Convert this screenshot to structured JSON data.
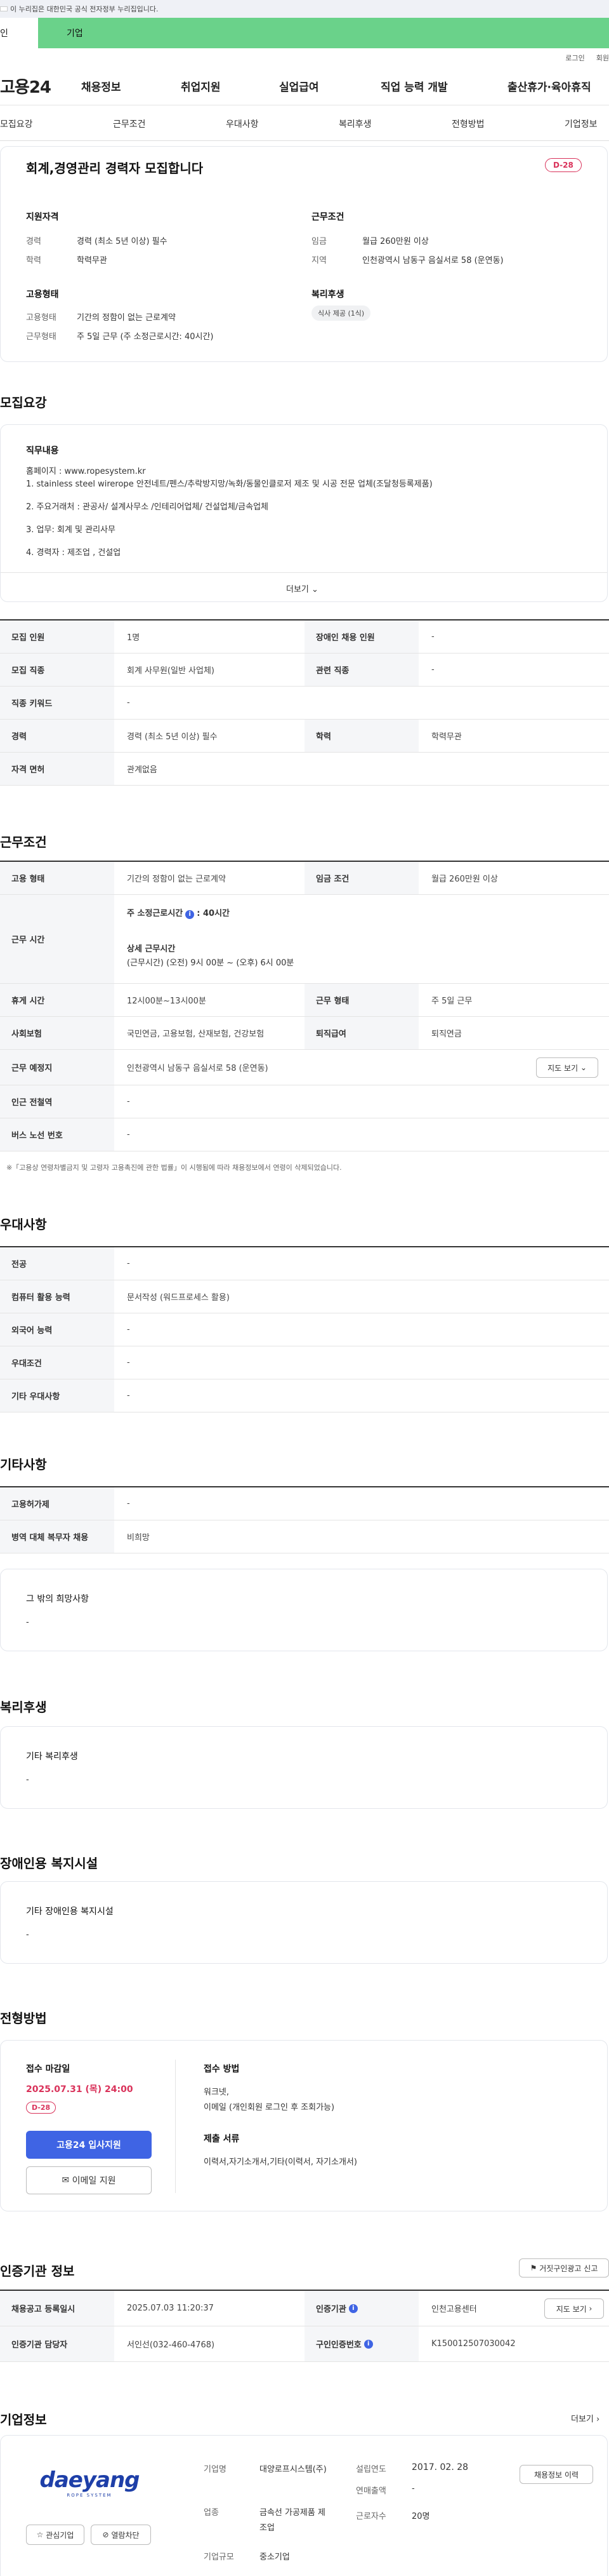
{
  "gov_banner": "이 누리집은 대한민국 공식 전자정부 누리집입니다.",
  "strip": {
    "left": "인",
    "right": "기업"
  },
  "util": [
    "로그인",
    "회원"
  ],
  "logo": "고용24",
  "gnb": [
    "채용정보",
    "취업지원",
    "실업급여",
    "직업 능력 개발",
    "출산휴가·육아휴직"
  ],
  "snb": [
    "모집요강",
    "근무조건",
    "우대사항",
    "복리후생",
    "전형방법",
    "기업정보"
  ],
  "summary": {
    "title": "회계,경영관리 경력자 모집합니다",
    "dday": "D-28",
    "qual_title": "지원자격",
    "career_k": "경력",
    "career_v": "경력 (최소 5년 이상) 필수",
    "edu_k": "학력",
    "edu_v": "학력무관",
    "cond_title": "근무조건",
    "wage_k": "임금",
    "wage_v": "월급 260만원 이상",
    "region_k": "지역",
    "region_v": "인천광역시 남동구 음실서로 58 (운연동)",
    "emp_title": "고용형태",
    "emptype_k": "고용형태",
    "emptype_v": "기간의 정함이 없는 근로계약",
    "worktype_k": "근무형태",
    "worktype_v": "주 5일 근무 (주 소정근로시간: 40시간)",
    "welfare_title": "복리후생",
    "welfare_chip": "식사 제공 (1식)"
  },
  "recruit": {
    "section": "모집요강",
    "duty_title": "직무내용",
    "duty_lines": [
      "홈페이지 : www.ropesystem.kr",
      "1. stainless steel wirerope 안전네트/펜스/추락방지망/녹화/동물인클로저 제조 및 시공 전문 업체(조달청등록제품)",
      "2. 주요거래처 : 관공사/ 설계사무소 /인테리어업체/ 건설업체/금속업체",
      "3. 업무: 회계 및 관리사무",
      "4. 경력자 : 제조업 , 건설업"
    ],
    "more": "더보기",
    "rows": [
      [
        "모집 인원",
        "1명",
        "장애인 채용 인원",
        "-"
      ],
      [
        "모집 직종",
        "회계 사무원(일반 사업체)",
        "관련 직종",
        "-"
      ],
      [
        "직종 키워드",
        "-"
      ],
      [
        "경력",
        "경력 (최소 5년 이상) 필수",
        "학력",
        "학력무관"
      ],
      [
        "자격 면허",
        "관계없음"
      ]
    ]
  },
  "work": {
    "section": "근무조건",
    "emp_k": "고용 형태",
    "emp_v": "기간의 정함이 없는 근로계약",
    "wage_k": "임금 조건",
    "wage_v": "월급 260만원 이상",
    "time_k": "근무 시간",
    "time_a": "주 소정근로시간",
    "time_b": ": 40시간",
    "time_c": "상세 근무시간",
    "time_d": "(근무시간) (오전) 9시 00분 ~ (오후) 6시 00분",
    "rest_k": "휴게 시간",
    "rest_v": "12시00분~13시00분",
    "form_k": "근무 형태",
    "form_v": "주 5일 근무",
    "ins_k": "사회보험",
    "ins_v": "국민연금, 고용보험, 산재보험, 건강보험",
    "ret_k": "퇴직급여",
    "ret_v": "퇴직연금",
    "place_k": "근무 예정지",
    "place_v": "인천광역시 남동구 음실서로 58 (운연동)",
    "map_btn": "지도 보기",
    "sub_k": "인근 전철역",
    "sub_v": "-",
    "bus_k": "버스 노선 번호",
    "bus_v": "-",
    "note": "※「고용상 연령차별금지 및 고령자 고용촉진에 관한 법률」이 시행됨에 따라 채용정보에서 연령이 삭제되었습니다."
  },
  "pref": {
    "section": "우대사항",
    "rows": [
      [
        "전공",
        "-"
      ],
      [
        "컴퓨터 활용 능력",
        "문서작성 (워드프로세스 활용)"
      ],
      [
        "외국어 능력",
        "-"
      ],
      [
        "우대조건",
        "-"
      ],
      [
        "기타 우대사항",
        "-"
      ]
    ]
  },
  "etc": {
    "section": "기타사항",
    "rows": [
      [
        "고용허가제",
        "-"
      ],
      [
        "병역 대체 복무자 채용",
        "비희망"
      ]
    ],
    "hope_title": "그 밖의 희망사항",
    "hope_v": "-"
  },
  "welfare": {
    "section": "복리후생",
    "title": "기타 복리후생",
    "v": "-"
  },
  "disab": {
    "section": "장애인용 복지시설",
    "title": "기타 장애인용 복지시설",
    "v": "-"
  },
  "selection": {
    "section": "전형방법",
    "deadline_k": "접수 마감일",
    "deadline_v": "2025.07.31 (목) 24:00",
    "dday": "D-28",
    "apply_btn": "고용24 입사지원",
    "email_btn": "이메일 지원",
    "method_k": "접수 방법",
    "method_v1": "워크넷,",
    "method_v2": "이메일 (개인회원 로그인 후 조회가능)",
    "docs_k": "제출 서류",
    "docs_v": "이력서,자기소개서,기타(이력서, 자기소개서)"
  },
  "agency": {
    "section": "인증기관 정보",
    "report_btn": "거짓구인광고 신고",
    "reg_k": "채용공고 등록일시",
    "reg_v": "2025.07.03 11:20:37",
    "org_k": "인증기관",
    "org_v": "인천고용센터",
    "map_btn": "지도 보기",
    "staff_k": "인증기관 담당자",
    "staff_v": "서인선(032-460-4768)",
    "num_k": "구인인증번호",
    "num_v": "K150012507030042"
  },
  "company": {
    "section": "기업정보",
    "more": "더보기",
    "logo_text": "daeyang",
    "logo_sub": "ROPE SYSTEM",
    "fav_btn": "관심기업",
    "block_btn": "열람차단",
    "name_k": "기업명",
    "name_v": "대양로프시스템(주)",
    "found_k": "설립연도",
    "found_v": "2017. 02. 28",
    "sales_k": "연매출액",
    "sales_v": "-",
    "ind_k": "업종",
    "ind_v": "금속선 가공제품 제조업",
    "emp_k": "근로자수",
    "emp_v": "20명",
    "scale_k": "기업규모",
    "scale_v": "중소기업",
    "info_btn": "채용정보 이력"
  }
}
